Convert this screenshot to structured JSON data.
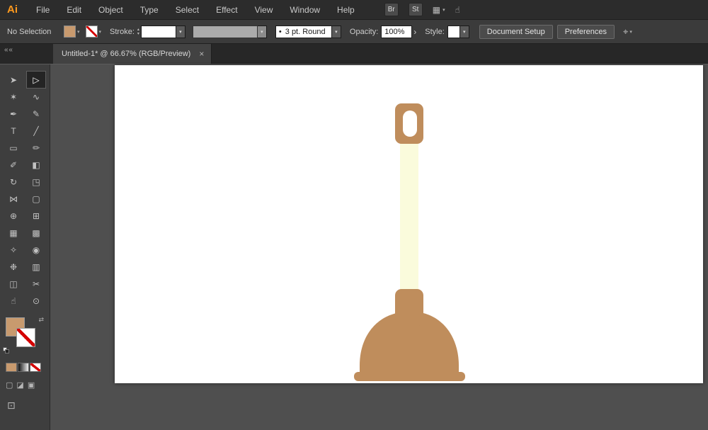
{
  "app": {
    "logo": "Ai",
    "menu_items": [
      "File",
      "Edit",
      "Object",
      "Type",
      "Select",
      "Effect",
      "View",
      "Window",
      "Help"
    ],
    "topbar": {
      "bridge_label": "Br",
      "stock_label": "St",
      "arrange_icon": "▦",
      "touch_icon": "☝"
    }
  },
  "glyphs": {
    "dropdown": "▾",
    "stepper_up": "▴",
    "stepper_down": "▾",
    "opacity_arrow": "›",
    "swap": "⇄",
    "collapse": "« «",
    "align": "⌖",
    "bullet": "•"
  },
  "control_bar": {
    "selection_status": "No Selection",
    "stroke_label": "Stroke:",
    "brush_label": "3 pt. Round",
    "opacity_label": "Opacity:",
    "opacity_value": "100%",
    "style_label": "Style:",
    "document_setup_label": "Document Setup",
    "preferences_label": "Preferences"
  },
  "document_tab": {
    "title": "Untitled-1* @ 66.67% (RGB/Preview)",
    "close_glyph": "×"
  },
  "toolbar": {
    "tools": [
      {
        "name": "selection-tool",
        "glyph": "➤",
        "active": false
      },
      {
        "name": "direct-selection-tool",
        "glyph": "▷",
        "active": true
      },
      {
        "name": "magic-wand-tool",
        "glyph": "✶",
        "active": false
      },
      {
        "name": "lasso-tool",
        "glyph": "∿",
        "active": false
      },
      {
        "name": "pen-tool",
        "glyph": "✒",
        "active": false
      },
      {
        "name": "curvature-tool",
        "glyph": "✎",
        "active": false
      },
      {
        "name": "type-tool",
        "glyph": "T",
        "active": false
      },
      {
        "name": "line-segment-tool",
        "glyph": "╱",
        "active": false
      },
      {
        "name": "rectangle-tool",
        "glyph": "▭",
        "active": false
      },
      {
        "name": "paintbrush-tool",
        "glyph": "✏",
        "active": false
      },
      {
        "name": "shaper-tool",
        "glyph": "✐",
        "active": false
      },
      {
        "name": "eraser-tool",
        "glyph": "◧",
        "active": false
      },
      {
        "name": "rotate-tool",
        "glyph": "↻",
        "active": false
      },
      {
        "name": "scale-tool",
        "glyph": "◳",
        "active": false
      },
      {
        "name": "width-tool",
        "glyph": "⋈",
        "active": false
      },
      {
        "name": "free-transform-tool",
        "glyph": "▢",
        "active": false
      },
      {
        "name": "shape-builder-tool",
        "glyph": "⊕",
        "active": false
      },
      {
        "name": "perspective-grid-tool",
        "glyph": "⊞",
        "active": false
      },
      {
        "name": "mesh-tool",
        "glyph": "▦",
        "active": false
      },
      {
        "name": "gradient-tool",
        "glyph": "▩",
        "active": false
      },
      {
        "name": "eyedropper-tool",
        "glyph": "✧",
        "active": false
      },
      {
        "name": "blend-tool",
        "glyph": "◉",
        "active": false
      },
      {
        "name": "symbol-sprayer-tool",
        "glyph": "❉",
        "active": false
      },
      {
        "name": "column-graph-tool",
        "glyph": "▥",
        "active": false
      },
      {
        "name": "artboard-tool",
        "glyph": "◫",
        "active": false
      },
      {
        "name": "slice-tool",
        "glyph": "✂",
        "active": false
      },
      {
        "name": "hand-tool",
        "glyph": "☝",
        "active": false
      },
      {
        "name": "zoom-tool",
        "glyph": "⊙",
        "active": false
      }
    ],
    "modes": {
      "draw_normal": "▢",
      "draw_behind": "◪",
      "draw_inside": "▣",
      "screen_mode": "⊡"
    }
  },
  "colors": {
    "tan_swatch": "#C89A6E"
  },
  "artwork": {
    "name": "plunger",
    "handle_color": "#BF8D5C",
    "stick_color": "#FAFBDC",
    "hole_color": "#FFFFFF"
  }
}
